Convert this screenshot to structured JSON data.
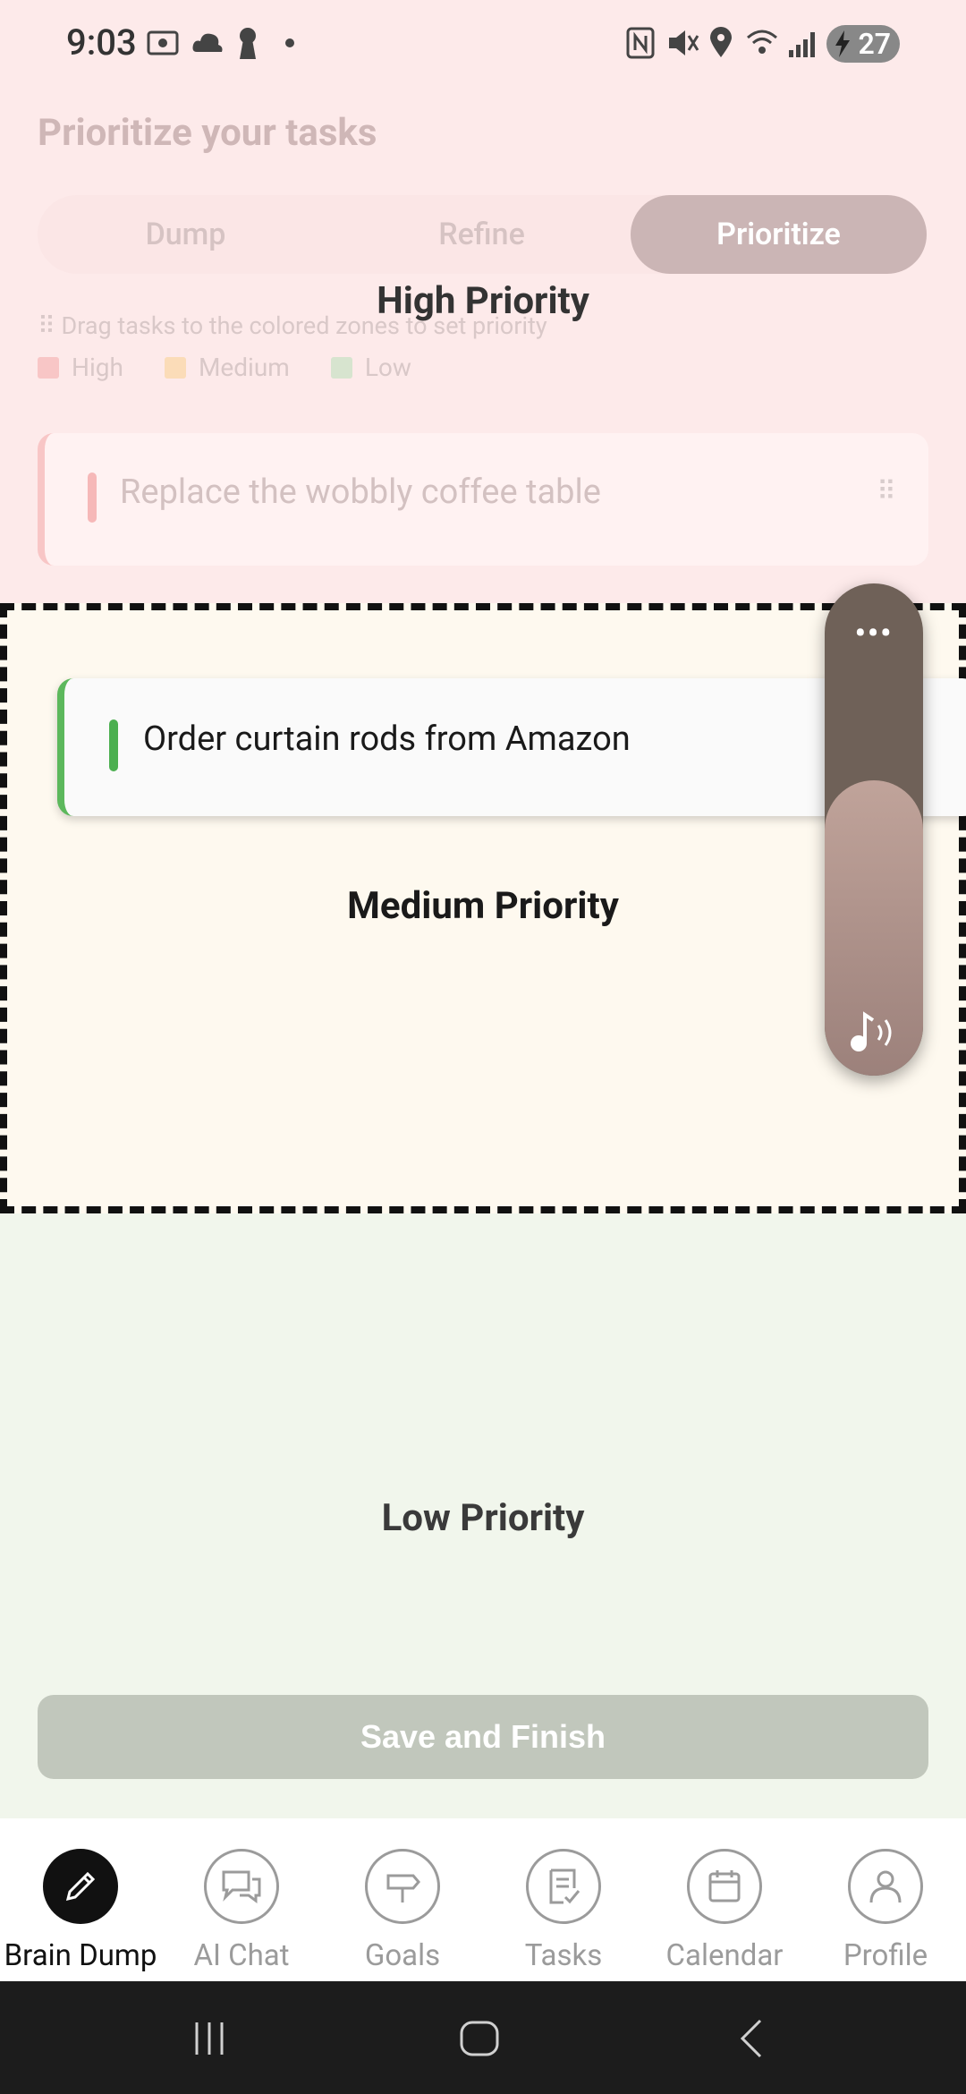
{
  "status_bar": {
    "time": "9:03",
    "battery": "27"
  },
  "page": {
    "title": "Prioritize your tasks",
    "tabs": [
      {
        "label": "Dump",
        "active": false
      },
      {
        "label": "Refine",
        "active": false
      },
      {
        "label": "Prioritize",
        "active": true
      }
    ],
    "hint": "Drag tasks to the colored zones to set priority",
    "legend": [
      {
        "label": "High",
        "color": "#f8c6c6"
      },
      {
        "label": "Medium",
        "color": "#fbdcb8"
      },
      {
        "label": "Low",
        "color": "#d7e4cf"
      }
    ]
  },
  "zones": {
    "high": "High Priority",
    "medium": "Medium Priority",
    "low": "Low Priority"
  },
  "tasks": {
    "high_task": "Replace the wobbly coffee table",
    "dragged_task": "Order curtain rods from Amazon"
  },
  "volume_overlay": {
    "more": "•••",
    "level": 0.6
  },
  "actions": {
    "save": "Save and Finish"
  },
  "nav": [
    {
      "label": "Brain Dump",
      "icon": "pencil-icon",
      "active": true
    },
    {
      "label": "AI Chat",
      "icon": "chat-icon",
      "active": false
    },
    {
      "label": "Goals",
      "icon": "signpost-icon",
      "active": false
    },
    {
      "label": "Tasks",
      "icon": "task-list-icon",
      "active": false
    },
    {
      "label": "Calendar",
      "icon": "calendar-icon",
      "active": false
    },
    {
      "label": "Profile",
      "icon": "profile-icon",
      "active": false
    }
  ],
  "colors": {
    "accent_green": "#4caf50",
    "nav_active": "#111111"
  }
}
